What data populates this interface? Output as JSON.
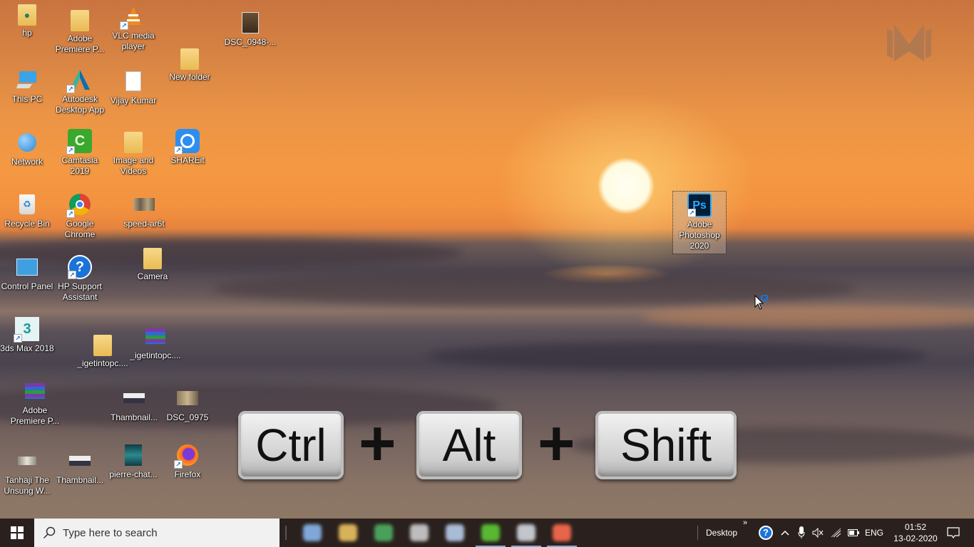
{
  "desktop": {
    "icons": [
      {
        "label": "hp",
        "icon": "user-folder-icon"
      },
      {
        "label": "Adobe Premiere P...",
        "icon": "folder-icon"
      },
      {
        "label": "VLC media player",
        "icon": "vlc-icon",
        "shortcut": true
      },
      {
        "label": "DSC_0948-...",
        "icon": "image-file-icon"
      },
      {
        "label": "This PC",
        "icon": "computer-icon"
      },
      {
        "label": "Autodesk Desktop App",
        "icon": "autodesk-icon",
        "shortcut": true
      },
      {
        "label": "Vijay Kumar",
        "icon": "document-icon"
      },
      {
        "label": "New folder",
        "icon": "folder-icon"
      },
      {
        "label": "Network",
        "icon": "network-icon"
      },
      {
        "label": "Camtasia 2019",
        "icon": "camtasia-icon",
        "shortcut": true
      },
      {
        "label": "Image and Videos",
        "icon": "folder-icon"
      },
      {
        "label": "SHAREit",
        "icon": "shareit-icon",
        "shortcut": true
      },
      {
        "label": "Recycle Bin",
        "icon": "recycle-bin-icon"
      },
      {
        "label": "Google Chrome",
        "icon": "chrome-icon",
        "shortcut": true
      },
      {
        "label": "speed-ar6t",
        "icon": "image-file-icon"
      },
      {
        "label": "Control Panel",
        "icon": "control-panel-icon"
      },
      {
        "label": "HP Support Assistant",
        "icon": "hp-support-icon",
        "shortcut": true
      },
      {
        "label": "Camera",
        "icon": "folder-icon"
      },
      {
        "label": "3ds Max 2018",
        "icon": "3ds-max-icon",
        "shortcut": true
      },
      {
        "label": "_igetintopc....",
        "icon": "folder-icon"
      },
      {
        "label": "_igetintopc....",
        "icon": "winrar-archive-icon"
      },
      {
        "label": "Adobe Premiere P...",
        "icon": "winrar-archive-icon"
      },
      {
        "label": "Thambnail...",
        "icon": "image-file-icon"
      },
      {
        "label": "DSC_0975",
        "icon": "image-file-icon"
      },
      {
        "label": "Tanhaji The Unsung W...",
        "icon": "video-file-icon"
      },
      {
        "label": "Thambnail...",
        "icon": "image-file-icon"
      },
      {
        "label": "pierre-chat...",
        "icon": "image-file-icon"
      },
      {
        "label": "Firefox",
        "icon": "firefox-icon",
        "shortcut": true
      },
      {
        "label": "Adobe Photoshop 2020",
        "icon": "photoshop-icon",
        "shortcut": true,
        "selected": true
      }
    ]
  },
  "overlay": {
    "keys": [
      "Ctrl",
      "Alt",
      "Shift"
    ],
    "separator": "+"
  },
  "watermark": {
    "icon": "channel-logo-icon"
  },
  "taskbar": {
    "start_icon": "windows-start-icon",
    "search_placeholder": "Type here to search",
    "pinned_apps": [
      {
        "name": "app-1",
        "color": "#7fa8d8",
        "running": false
      },
      {
        "name": "file-explorer",
        "color": "#d8b25a",
        "running": false
      },
      {
        "name": "google-chrome",
        "color": "#4aa05a",
        "running": false
      },
      {
        "name": "app-4",
        "color": "#bdbdbd",
        "running": false
      },
      {
        "name": "app-5",
        "color": "#a9bcd6",
        "running": false
      },
      {
        "name": "camtasia",
        "color": "#58b832",
        "running": true
      },
      {
        "name": "app-7",
        "color": "#c2c6cc",
        "running": true
      },
      {
        "name": "app-8",
        "color": "#e8644a",
        "running": true
      }
    ],
    "toolbar_label": "Desktop",
    "toolbar_expand": "»",
    "tray": {
      "language": "ENG",
      "time": "01:52",
      "date": "13-02-2020"
    }
  },
  "colors": {
    "taskbar_bg": "#2a211e",
    "search_bg": "#f1f1f1",
    "accent": "#1a73d9"
  }
}
